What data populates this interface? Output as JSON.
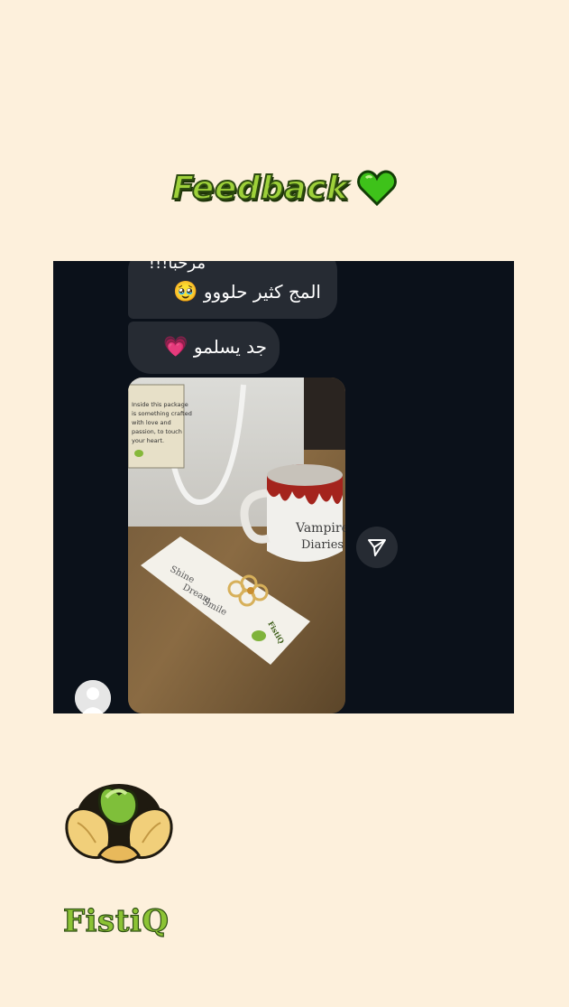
{
  "header": {
    "title": "Feedback",
    "heart_icon": "green-heart-icon",
    "title_color": "#9ed13a"
  },
  "chat": {
    "messages": [
      {
        "line1": "مرحبا!!!",
        "line2": "المج كثير حلووو",
        "emoji": "🥹"
      },
      {
        "line": "جد يسلمو",
        "emoji": "💗"
      }
    ],
    "photo": {
      "note_lines": [
        "Inside this package",
        "is something crafted",
        "with love and",
        "passion, to touch",
        "your heart."
      ],
      "mug_text_1": "Vampire",
      "mug_text_2": "Diaries",
      "bookmark_lines": [
        "Shine",
        "Dream",
        "Smile"
      ],
      "bookmark_brand": "FistiQ"
    },
    "share_icon": "send-icon",
    "avatar_icon": "default-avatar-icon",
    "background": "#0b111a",
    "bubble_color": "#262b33"
  },
  "brand": {
    "name": "FistiQ",
    "logo_icon": "pistachio-logo-icon",
    "name_color": "#8cc334"
  }
}
